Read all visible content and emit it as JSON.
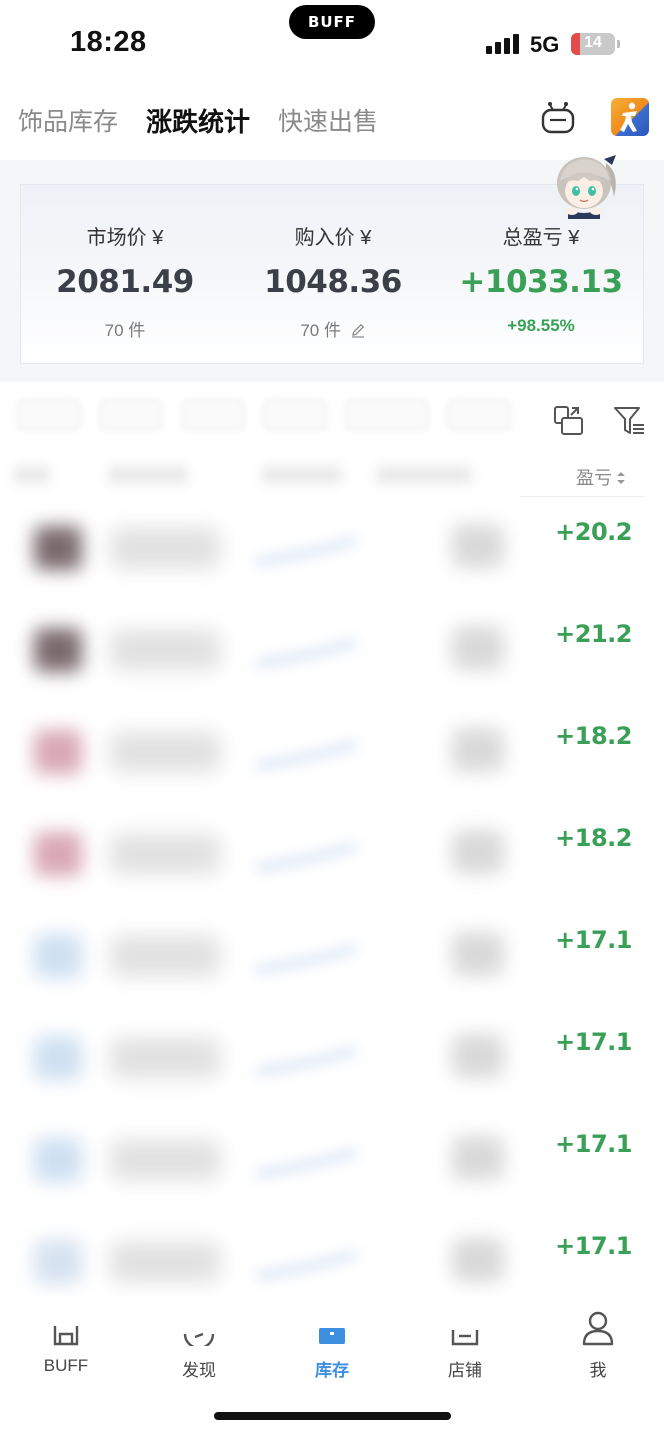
{
  "status_bar": {
    "time": "18:28",
    "island_logo": "BUFF",
    "network": "5G",
    "battery": "14",
    "battery_level": 0.14,
    "signal_bars": 4
  },
  "top_tabs": [
    {
      "label": "饰品库存",
      "active": false
    },
    {
      "label": "涨跌统计",
      "active": true
    },
    {
      "label": "快速出售",
      "active": false
    }
  ],
  "top_actions": {
    "robot_icon": "robot-icon",
    "game_icon": "csgo-game-icon"
  },
  "summary": {
    "market": {
      "label": "市场价 ¥",
      "value": "2081.49",
      "count": "70 件"
    },
    "purchase": {
      "label": "购入价 ¥",
      "value": "1048.36",
      "count": "70 件"
    },
    "profit": {
      "label": "总盈亏 ¥",
      "value": "+1033.13",
      "percent": "+98.55%"
    }
  },
  "toolbar": {
    "share_icon": "share-icon",
    "filter_icon": "filter-icon",
    "sort_label": "盈亏"
  },
  "items": [
    {
      "profit": "+20.2",
      "thumb_color": "#7a6a6e"
    },
    {
      "profit": "+21.2",
      "thumb_color": "#7a6a6e"
    },
    {
      "profit": "+18.2",
      "thumb_color": "#d9a8b6"
    },
    {
      "profit": "+18.2",
      "thumb_color": "#d9a8b6"
    },
    {
      "profit": "+17.1",
      "thumb_color": "#cfe0f2"
    },
    {
      "profit": "+17.1",
      "thumb_color": "#cfe0f2"
    },
    {
      "profit": "+17.1",
      "thumb_color": "#cfe0f2"
    },
    {
      "profit": "+17.1",
      "thumb_color": "#d6e2f0"
    }
  ],
  "bottom_nav": [
    {
      "label": "BUFF",
      "icon": "buff-home-icon",
      "active": false
    },
    {
      "label": "发现",
      "icon": "discover-icon",
      "active": false
    },
    {
      "label": "库存",
      "icon": "inventory-icon",
      "active": true
    },
    {
      "label": "店铺",
      "icon": "shop-icon",
      "active": false
    },
    {
      "label": "我",
      "icon": "profile-icon",
      "active": false
    }
  ],
  "colors": {
    "profit_green": "#3aa057",
    "nav_active_blue": "#3d8fe0",
    "value_dark": "#3a3f48"
  }
}
